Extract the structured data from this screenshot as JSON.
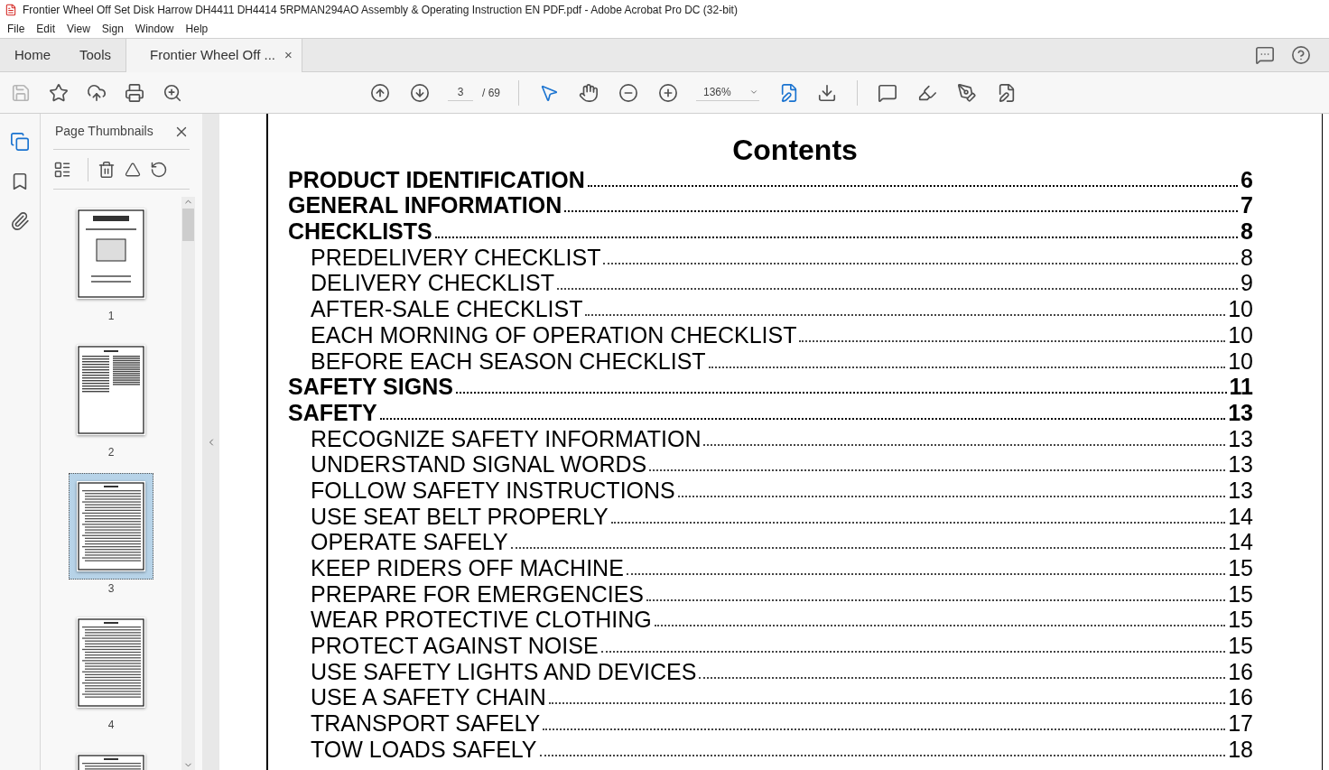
{
  "window": {
    "title": "Frontier Wheel Off Set Disk Harrow DH4411 DH4414 5RPMAN294AO Assembly & Operating Instruction EN PDF.pdf - Adobe Acrobat Pro DC (32-bit)"
  },
  "menu": [
    "File",
    "Edit",
    "View",
    "Sign",
    "Window",
    "Help"
  ],
  "tabs": [
    {
      "label": "Home",
      "selected": false,
      "kind": "nav"
    },
    {
      "label": "Tools",
      "selected": false,
      "kind": "nav"
    },
    {
      "label": "Frontier Wheel Off ...",
      "selected": true,
      "kind": "document",
      "close": "×"
    }
  ],
  "toolbar": {
    "page": "3",
    "page_total": "/ 69",
    "zoom": "136%"
  },
  "sidebar": {
    "title": "Page Thumbnails",
    "thumbnails": [
      {
        "label": "1",
        "selected": false,
        "kind": "cover"
      },
      {
        "label": "2",
        "selected": false,
        "kind": "columns"
      },
      {
        "label": "3",
        "selected": true,
        "kind": "contents"
      },
      {
        "label": "4",
        "selected": false,
        "kind": "contents"
      },
      {
        "selected": false,
        "kind": "contents"
      }
    ]
  },
  "document": {
    "title": "Contents",
    "entries": [
      {
        "text": "PRODUCT IDENTIFICATION",
        "page": "6"
      },
      {
        "text": "GENERAL INFORMATION",
        "page": "7"
      },
      {
        "text": "CHECKLISTS",
        "page": "8",
        "children": [
          {
            "text": "PREDELIVERY CHECKLIST",
            "page": "8"
          },
          {
            "text": "DELIVERY CHECKLIST",
            "page": "9"
          },
          {
            "text": "AFTER-SALE CHECKLIST",
            "page": "10"
          },
          {
            "text": "EACH MORNING OF OPERATION CHECKLIST",
            "page": "10"
          },
          {
            "text": "BEFORE EACH SEASON CHECKLIST",
            "page": "10"
          }
        ]
      },
      {
        "text": "SAFETY SIGNS",
        "page": "11"
      },
      {
        "text": "SAFETY",
        "page": "13",
        "children": [
          {
            "text": "RECOGNIZE SAFETY INFORMATION",
            "page": "13"
          },
          {
            "text": "UNDERSTAND SIGNAL WORDS",
            "page": "13"
          },
          {
            "text": "FOLLOW SAFETY INSTRUCTIONS",
            "page": "13"
          },
          {
            "text": "USE SEAT BELT PROPERLY",
            "page": "14"
          },
          {
            "text": "OPERATE SAFELY",
            "page": "14"
          },
          {
            "text": "KEEP RIDERS OFF MACHINE",
            "page": "15"
          },
          {
            "text": "PREPARE FOR EMERGENCIES",
            "page": "15"
          },
          {
            "text": "WEAR PROTECTIVE CLOTHING",
            "page": "15"
          },
          {
            "text": "PROTECT AGAINST NOISE",
            "page": "15"
          },
          {
            "text": "USE SAFETY LIGHTS AND DEVICES",
            "page": "16"
          },
          {
            "text": "USE A SAFETY CHAIN",
            "page": "16"
          },
          {
            "text": "TRANSPORT SAFELY",
            "page": "17"
          },
          {
            "text": "TOW LOADS SAFELY",
            "page": "18"
          }
        ]
      }
    ]
  }
}
